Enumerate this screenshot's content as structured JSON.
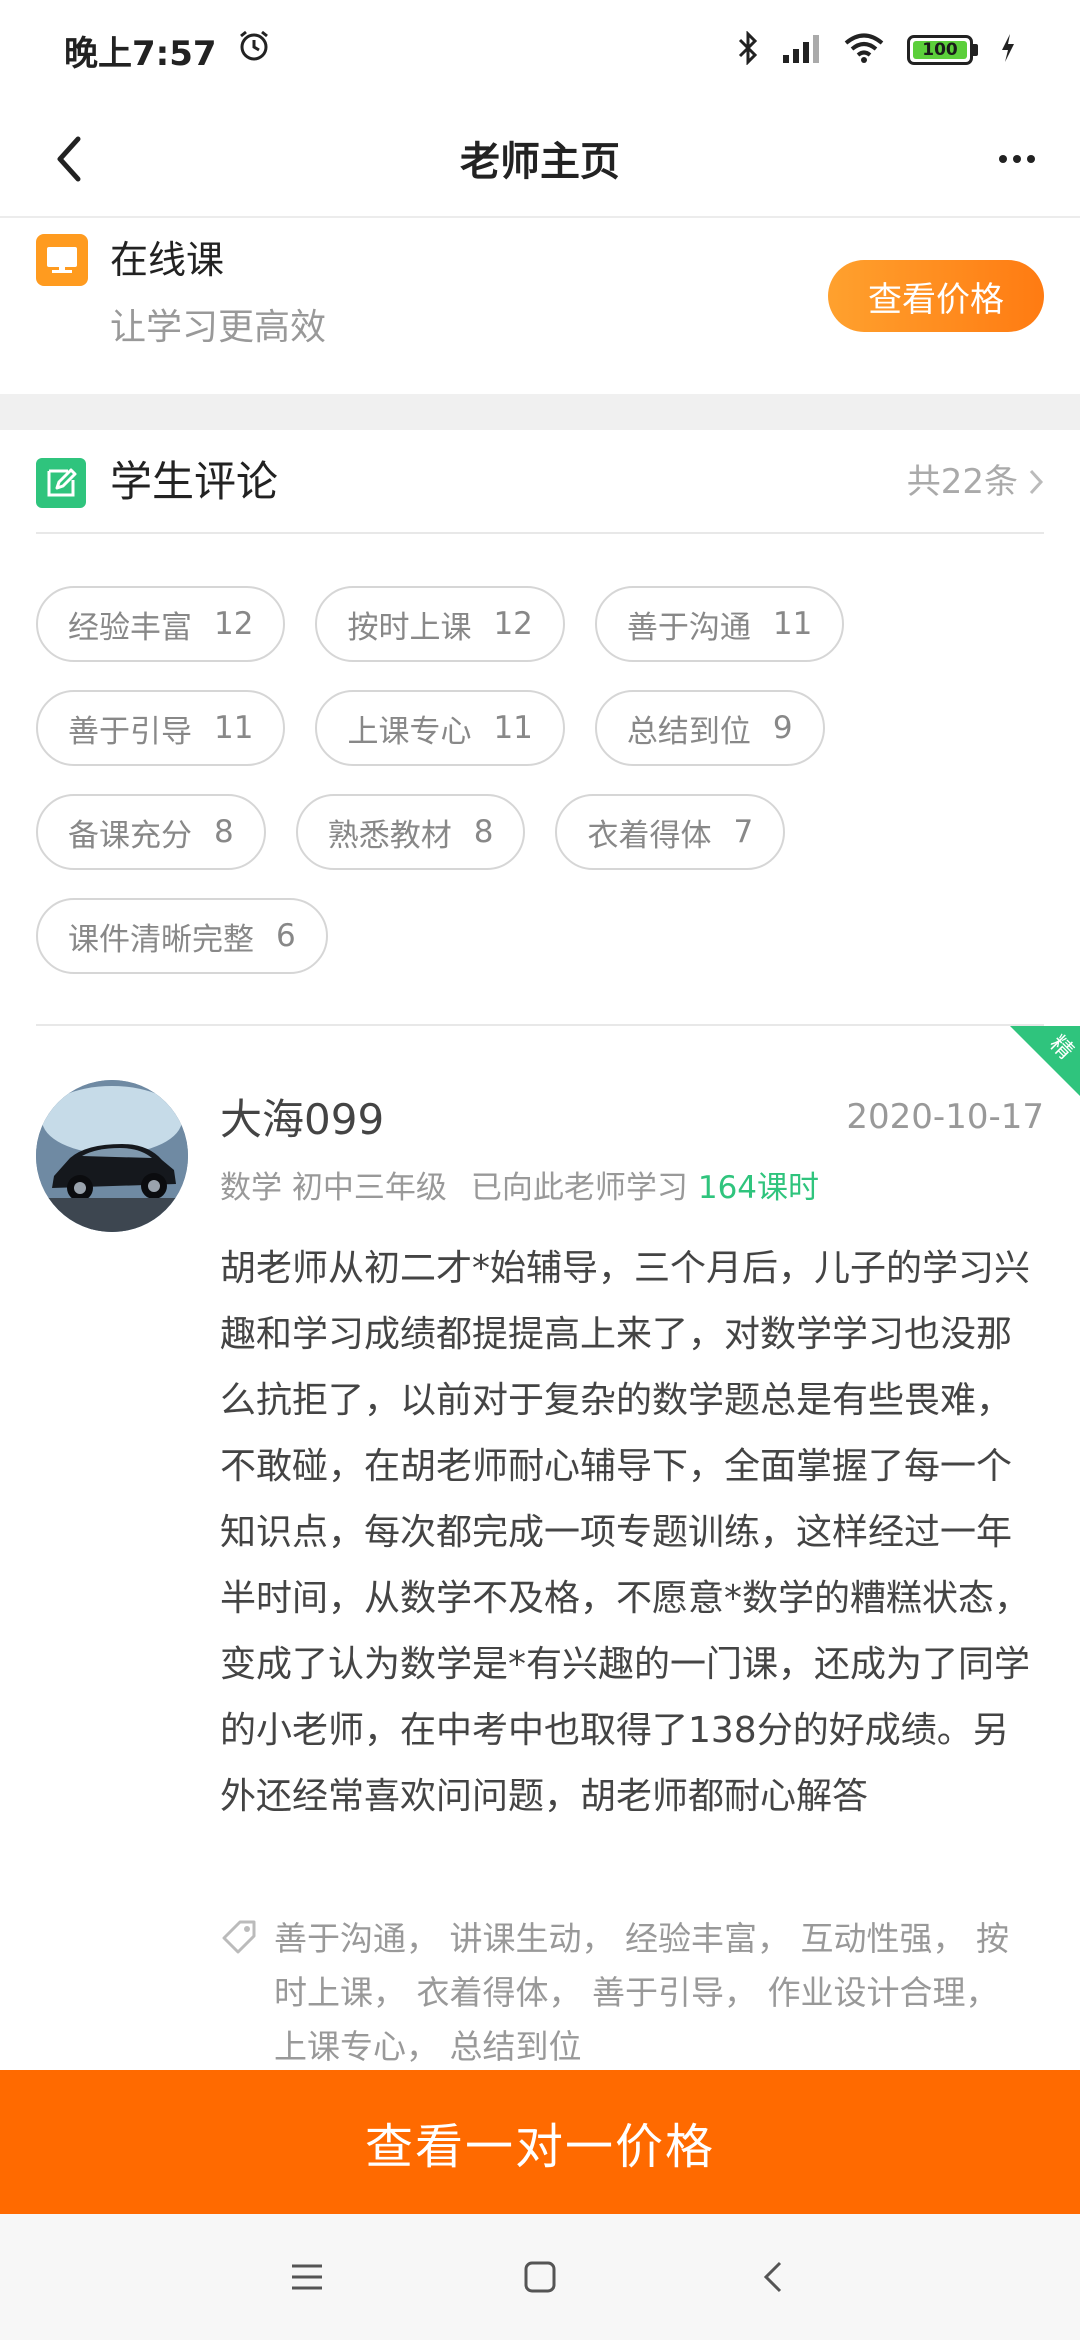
{
  "status_bar": {
    "time": "晚上7:57",
    "battery": "100"
  },
  "nav": {
    "title": "老师主页"
  },
  "online_course": {
    "title": "在线课",
    "subtitle": "让学习更高效",
    "price_button": "查看价格"
  },
  "reviews": {
    "title": "学生评论",
    "total": "共22条",
    "tags": [
      {
        "label": "经验丰富",
        "count": "12"
      },
      {
        "label": "按时上课",
        "count": "12"
      },
      {
        "label": "善于沟通",
        "count": "11"
      },
      {
        "label": "善于引导",
        "count": "11"
      },
      {
        "label": "上课专心",
        "count": "11"
      },
      {
        "label": "总结到位",
        "count": "9"
      },
      {
        "label": "备课充分",
        "count": "8"
      },
      {
        "label": "熟悉教材",
        "count": "8"
      },
      {
        "label": "衣着得体",
        "count": "7"
      },
      {
        "label": "课件清晰完整",
        "count": "6"
      }
    ]
  },
  "review_item": {
    "badge": "精",
    "name": "大海099",
    "date": "2020-10-17",
    "subject": "数学 初中三年级",
    "learned_prefix": "已向此老师学习",
    "hours": "164课时",
    "content": "胡老师从初二才*始辅导，三个月后，儿子的学习兴趣和学习成绩都提提高上来了，对数学学习也没那么抗拒了，以前对于复杂的数学题总是有些畏难，不敢碰，在胡老师耐心辅导下，全面掌握了每一个知识点，每次都完成一项专题训练，这样经过一年半时间，从数学不及格，不愿意*数学的糟糕状态，变成了认为数学是*有兴趣的一门课，还成为了同学的小老师，在中考中也取得了138分的好成绩。另外还经常喜欢问问题，胡老师都耐心解答",
    "tags_text": "善于沟通， 讲课生动， 经验丰富， 互动性强， 按时上课， 衣着得体， 善于引导， 作业设计合理， 上课专心， 总结到位"
  },
  "cta": {
    "label": "查看一对一价格"
  },
  "colors": {
    "accent_orange": "#ff6a00",
    "accent_green": "#2fc47d"
  }
}
